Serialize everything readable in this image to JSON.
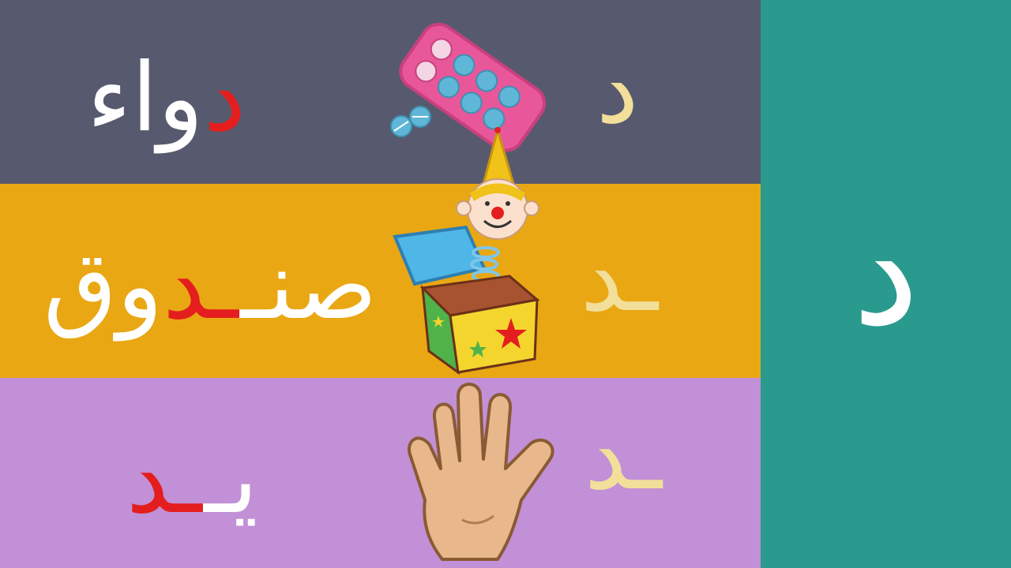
{
  "colors": {
    "row1_bg": "#575a6e",
    "row2_bg": "#e9a714",
    "row3_bg": "#c290d6",
    "side_bg": "#2b9a8e",
    "highlight": "#e41e1e",
    "word_text": "#ffffff",
    "letter_form": "#f1df9a",
    "big_letter": "#ffffff"
  },
  "side_panel": {
    "letter": "د"
  },
  "rows": [
    {
      "letter_form": "د",
      "word_parts": [
        "د",
        "واء"
      ],
      "picture_icon": "medicine-pills-icon"
    },
    {
      "letter_form": "ـد",
      "word_parts": [
        "صنـ",
        "ـد",
        "وق"
      ],
      "picture_icon": "jack-in-the-box-icon"
    },
    {
      "letter_form": "ـد",
      "word_parts": [
        "يـ",
        "ـد"
      ],
      "picture_icon": "hand-icon"
    }
  ]
}
